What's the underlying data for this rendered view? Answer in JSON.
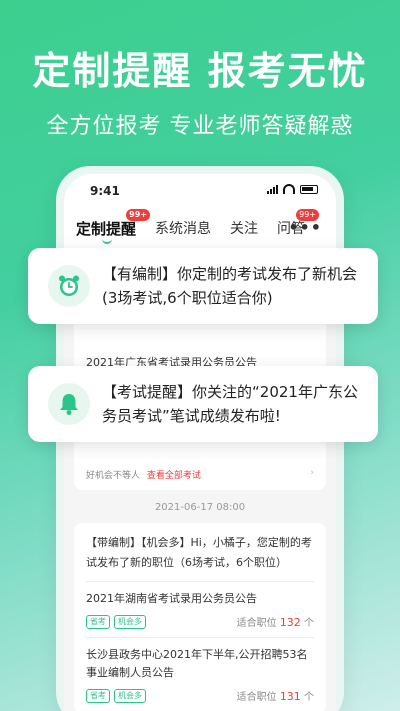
{
  "headline": "定制提醒  报考无忧",
  "subline": "全方位报考  专业老师答疑解惑",
  "status": {
    "time": "9:41"
  },
  "tabs": [
    {
      "label": "定制提醒",
      "badge": "99+"
    },
    {
      "label": "系统消息"
    },
    {
      "label": "关注"
    },
    {
      "label": "问答",
      "badge": "99+"
    }
  ],
  "more_label": "•••",
  "notifications": [
    {
      "text": "【有编制】你定制的考试发布了新机会(3场考试,6个职位适合你)",
      "icon": "alarm-clock-icon"
    },
    {
      "text": "【考试提醒】你关注的“2021年广东公务员考试”笔试成绩发布啦!",
      "icon": "bell-icon"
    }
  ],
  "background_card": {
    "item_title": "2021年广东省考试录用公务员公告",
    "footer_text": "好机会不等人",
    "footer_link": "查看全部考试"
  },
  "timestamp": "2021-06-17 08:00",
  "message_card": {
    "title": "【带编制】【机会多】Hi，小橘子，您定制的考试发布了新的职位（6场考试，6个职位）",
    "items": [
      {
        "title": "2021年湖南省考试录用公务员公告",
        "tags": [
          "省考",
          "机会多"
        ],
        "meta_prefix": "适合职位",
        "count": "132",
        "meta_suffix": "个"
      },
      {
        "title": "长沙县政务中心2021年下半年,公开招聘53名事业编制人员公告",
        "tags": [
          "省考",
          "机会多"
        ],
        "meta_prefix": "适合职位",
        "count": "131",
        "meta_suffix": "个"
      }
    ]
  },
  "colors": {
    "accent": "#2bc48a",
    "badge": "#f23b3b"
  }
}
